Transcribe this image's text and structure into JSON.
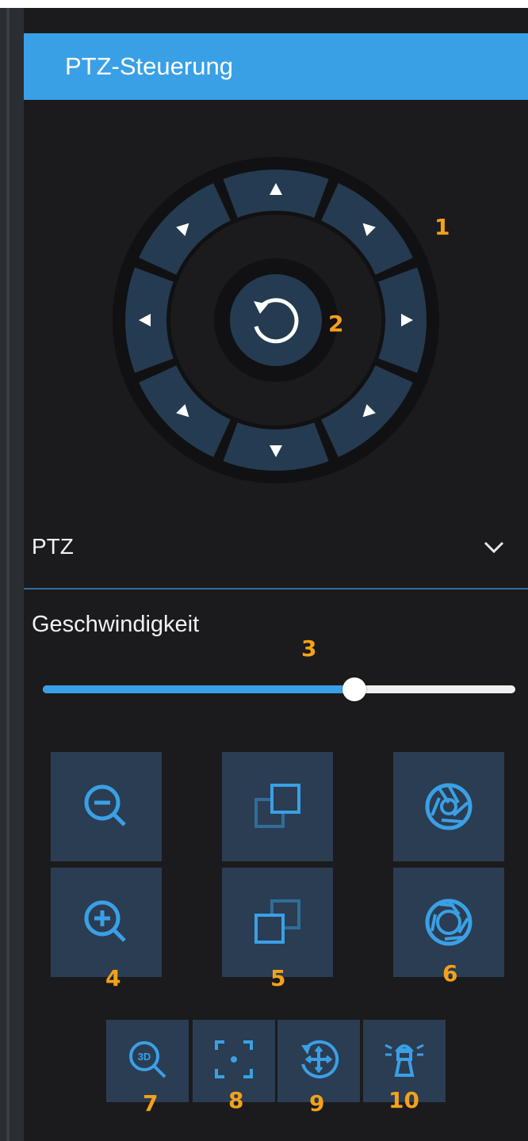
{
  "panel": {
    "title": "PTZ-Steuerung"
  },
  "joystick": {
    "directions": [
      "up",
      "up-right",
      "right",
      "down-right",
      "down",
      "down-left",
      "left",
      "up-left"
    ],
    "center_icon": "reset-icon"
  },
  "mode": {
    "label": "PTZ",
    "icon": "chevron-down-icon"
  },
  "speed": {
    "label": "Geschwindigkeit",
    "value": 0.66
  },
  "buttons": {
    "zoom_out": "zoom-out-icon",
    "zoom_in": "zoom-in-icon",
    "focus_far": "focus-far-icon",
    "focus_near": "focus-near-icon",
    "iris_close": "iris-close-icon",
    "iris_open": "iris-open-icon",
    "zoom_3d": "3d-positioning-icon",
    "center_focus": "center-focus-icon",
    "auto_scan": "auto-scan-icon",
    "light": "light-icon"
  },
  "callouts": [
    "1",
    "2",
    "3",
    "4",
    "5",
    "6",
    "7",
    "8",
    "9",
    "10"
  ],
  "colors": {
    "accent": "#3aa0e6",
    "button_bg": "#2b3d52",
    "callout": "#f4a11a",
    "background": "#1b1b1d"
  }
}
